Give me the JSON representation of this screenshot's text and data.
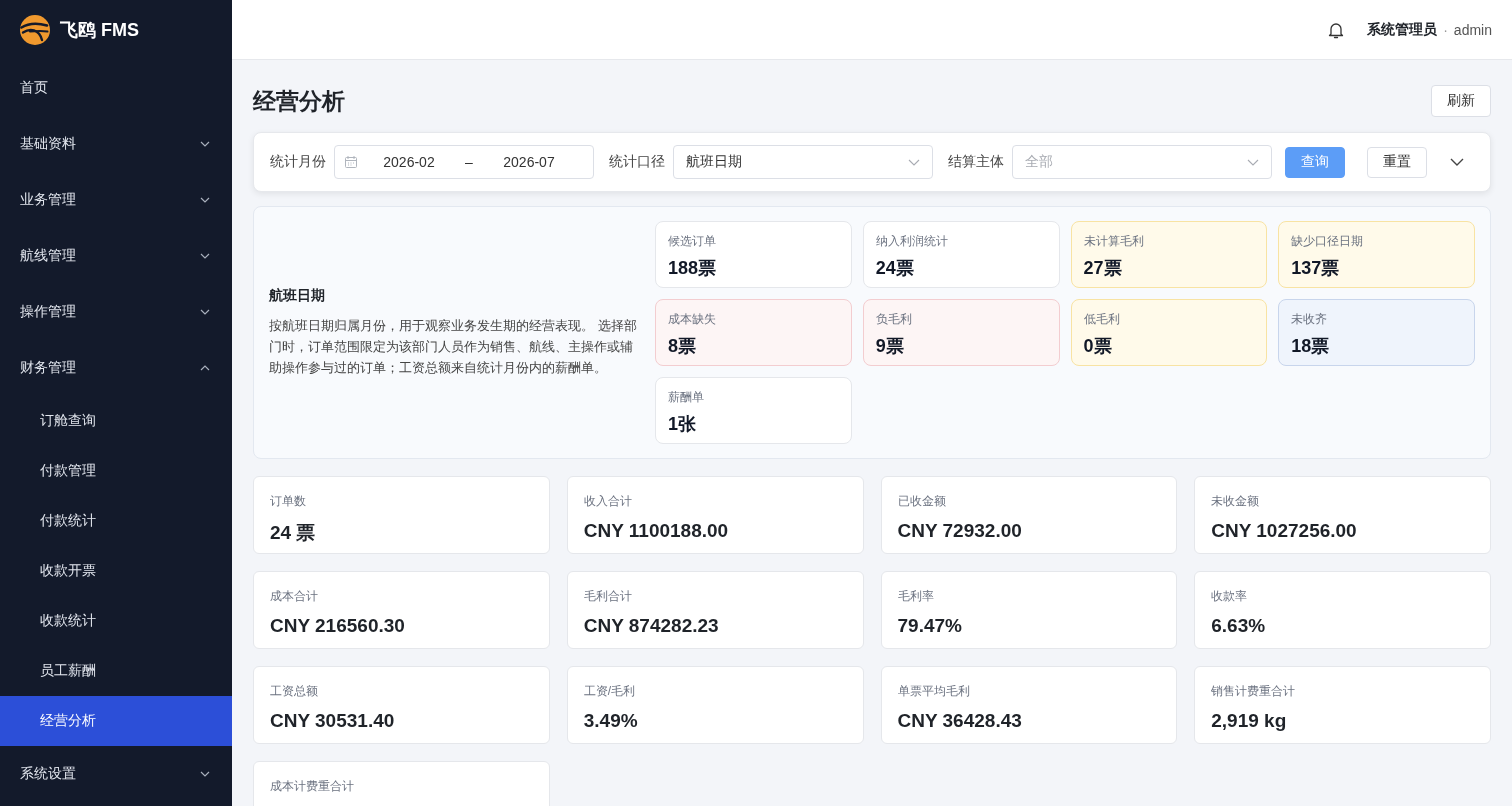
{
  "app": {
    "logo_text": "飞鸥 FMS"
  },
  "sidebar": {
    "items": [
      {
        "kind": "link",
        "label": "首页",
        "selected": false
      },
      {
        "kind": "group",
        "label": "基础资料",
        "selected": false,
        "expanded": false
      },
      {
        "kind": "group",
        "label": "业务管理",
        "selected": false,
        "expanded": false
      },
      {
        "kind": "group",
        "label": "航线管理",
        "selected": false,
        "expanded": false
      },
      {
        "kind": "group",
        "label": "操作管理",
        "selected": false,
        "expanded": false
      },
      {
        "kind": "group",
        "label": "财务管理",
        "selected": false,
        "expanded": true,
        "children": [
          {
            "label": "订舱查询",
            "selected": false
          },
          {
            "label": "付款管理",
            "selected": false
          },
          {
            "label": "付款统计",
            "selected": false
          },
          {
            "label": "收款开票",
            "selected": false
          },
          {
            "label": "收款统计",
            "selected": false
          },
          {
            "label": "员工薪酬",
            "selected": false
          },
          {
            "label": "经营分析",
            "selected": true
          }
        ]
      },
      {
        "kind": "group",
        "label": "系统设置",
        "selected": false,
        "expanded": false
      }
    ]
  },
  "top_bar": {
    "user": {
      "name": "系统管理员",
      "separator": "·",
      "account": "admin"
    }
  },
  "page": {
    "title": "经营分析",
    "refresh_button": "刷新"
  },
  "filter": {
    "expanded": false,
    "fields": [
      {
        "kind": "date-range",
        "label": "统计月份",
        "start": "2026-02",
        "separator": "–",
        "end": "2026-07"
      },
      {
        "kind": "select",
        "label": "统计口径",
        "value": "航班日期"
      },
      {
        "kind": "select",
        "label": "结算主体",
        "placeholder": "全部"
      }
    ],
    "buttons": [
      {
        "kind": "primary",
        "label": "查询"
      },
      {
        "kind": "default",
        "label": "重置"
      }
    ]
  },
  "summary": {
    "title": "航班日期",
    "description": "按航班日期归属月份，用于观察业务发生期的经营表现。 选择部门时，订单范围限定为该部门人员作为销售、航线、主操作或辅助操作参与过的订单；工资总额来自统计月份内的薪酬单。",
    "cards": [
      {
        "kind": "normal",
        "label": "候选订单",
        "value": "188票"
      },
      {
        "kind": "normal",
        "label": "纳入利润统计",
        "value": "24票"
      },
      {
        "kind": "warning",
        "label": "未计算毛利",
        "value": "27票"
      },
      {
        "kind": "warning",
        "label": "缺少口径日期",
        "value": "137票"
      },
      {
        "kind": "danger",
        "label": "成本缺失",
        "value": "8票"
      },
      {
        "kind": "danger",
        "label": "负毛利",
        "value": "9票"
      },
      {
        "kind": "warning",
        "label": "低毛利",
        "value": "0票"
      },
      {
        "kind": "info",
        "label": "未收齐",
        "value": "18票"
      },
      {
        "kind": "normal",
        "label": "薪酬单",
        "value": "1张"
      }
    ]
  },
  "metrics": [
    {
      "label": "订单数",
      "value": "24 票"
    },
    {
      "label": "收入合计",
      "value": "CNY 1100188.00"
    },
    {
      "label": "已收金额",
      "value": "CNY 72932.00"
    },
    {
      "label": "未收金额",
      "value": "CNY 1027256.00"
    },
    {
      "label": "成本合计",
      "value": "CNY 216560.30"
    },
    {
      "label": "毛利合计",
      "value": "CNY 874282.23"
    },
    {
      "label": "毛利率",
      "value": "79.47%"
    },
    {
      "label": "收款率",
      "value": "6.63%"
    },
    {
      "label": "工资总额",
      "value": "CNY 30531.40"
    },
    {
      "label": "工资/毛利",
      "value": "3.49%"
    },
    {
      "label": "单票平均毛利",
      "value": "CNY 36428.43"
    },
    {
      "label": "销售计费重合计",
      "value": "2,919 kg"
    },
    {
      "label": "成本计费重合计"
    }
  ]
}
